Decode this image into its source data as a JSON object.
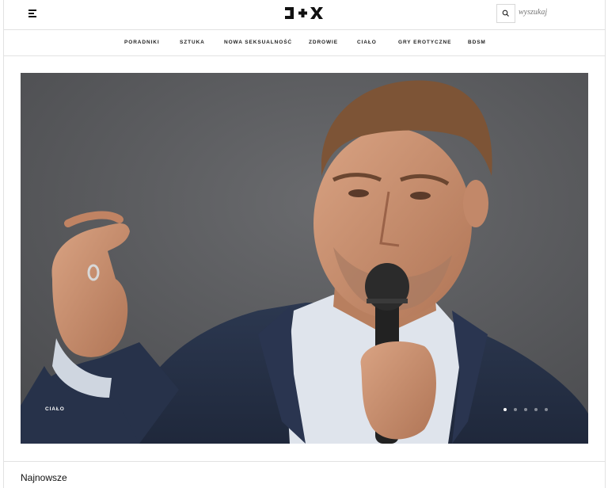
{
  "header": {
    "logo_label": "ɔ+X",
    "search_placeholder": "wyszukaj"
  },
  "nav": {
    "items": [
      "PORADNIKI",
      "SZTUKA",
      "NOWA SEKSUALNOŚĆ",
      "ZDROWIE",
      "CIAŁO",
      "GRY EROTYCZNE",
      "BDSM"
    ]
  },
  "hero": {
    "category": "CIAŁO",
    "carousel": {
      "slides": 5,
      "active": 1
    }
  },
  "sections": {
    "latest_title": "Najnowsze"
  },
  "colors": {
    "hero_background": "#56575a",
    "border": "#e2e2e2",
    "text": "#111111"
  }
}
